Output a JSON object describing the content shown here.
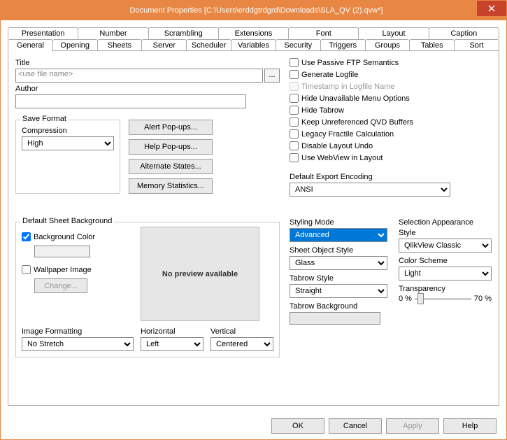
{
  "window": {
    "title": "Document Properties [C:\\Users\\erddgtrdgrd\\Downloads\\SLA_QV (2).qvw*]"
  },
  "tabs_row1": [
    "Presentation",
    "Number",
    "Scrambling",
    "Extensions",
    "Font",
    "Layout",
    "Caption"
  ],
  "tabs_row2": [
    "General",
    "Opening",
    "Sheets",
    "Server",
    "Scheduler",
    "Variables",
    "Security",
    "Triggers",
    "Groups",
    "Tables",
    "Sort"
  ],
  "active_tab": "General",
  "labels": {
    "title": "Title",
    "title_placeholder": "<use file name>",
    "browse": "...",
    "author": "Author",
    "save_format": "Save Format",
    "compression": "Compression",
    "alert": "Alert Pop-ups...",
    "help": "Help Pop-ups...",
    "altstates": "Alternate States...",
    "memstats": "Memory Statistics...",
    "default_sheet_bg": "Default Sheet Background",
    "bgcolor": "Background Color",
    "wallpaper": "Wallpaper Image",
    "change": "Change...",
    "nopreview": "No preview available",
    "img_fmt": "Image Formatting",
    "horiz": "Horizontal",
    "vert": "Vertical",
    "def_export_enc": "Default Export Encoding",
    "styling_mode": "Styling Mode",
    "sheet_obj_style": "Sheet Object Style",
    "tabrow_style": "Tabrow Style",
    "tabrow_bg": "Tabrow Background",
    "sel_appearance": "Selection Appearance",
    "style": "Style",
    "color_scheme": "Color Scheme",
    "transparency": "Transparency",
    "trans_min": "0 %",
    "trans_max": "70 %"
  },
  "values": {
    "compression": "High",
    "img_fmt": "No Stretch",
    "horiz": "Left",
    "vert": "Centered",
    "encoding": "ANSI",
    "styling_mode": "Advanced",
    "sheet_obj_style": "Glass",
    "tabrow_style": "Straight",
    "sel_style": "QlikView Classic",
    "color_scheme": "Light"
  },
  "checks": {
    "passive_ftp": "Use Passive FTP Semantics",
    "gen_logfile": "Generate Logfile",
    "timestamp_logfile": "Timestamp in Logfile Name",
    "hide_menu": "Hide Unavailable Menu Options",
    "hide_tabrow": "Hide Tabrow",
    "keep_qvd": "Keep Unreferenced QVD Buffers",
    "legacy_fractile": "Legacy Fractile Calculation",
    "disable_undo": "Disable Layout Undo",
    "webview": "Use WebView in Layout"
  },
  "buttons": {
    "ok": "OK",
    "cancel": "Cancel",
    "apply": "Apply",
    "help": "Help"
  }
}
